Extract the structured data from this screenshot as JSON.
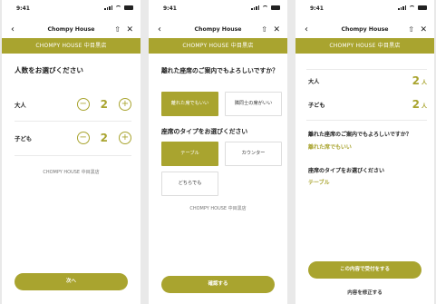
{
  "status": {
    "time": "9:41"
  },
  "nav": {
    "title": "Chompy House",
    "back": "‹",
    "share": "⇧",
    "close": "✕"
  },
  "banner": "CHOMPY HOUSE 中目黒店",
  "screen1": {
    "heading": "人数をお選びください",
    "adult_label": "大人",
    "adult_count": "2",
    "child_label": "子ども",
    "child_count": "2",
    "minus": "−",
    "plus": "+",
    "store": "CHOMPY HOUSE 中目黒店",
    "next_button": "次へ"
  },
  "screen2": {
    "question1": "離れた座席のご案内でもよろしいですか？",
    "q1_options": [
      "離れた席でもいい",
      "隣同士の席がいい"
    ],
    "q1_selected": "離れた席でもいい",
    "question2": "座席のタイプをお選びください",
    "q2_options": [
      "テーブル",
      "カウンター",
      "どちらでも"
    ],
    "q2_selected": "テーブル",
    "store": "CHOMPY HOUSE 中目黒店",
    "confirm_button": "確認する"
  },
  "screen3": {
    "adult_label": "大人",
    "adult_value": "2",
    "child_label": "子ども",
    "child_value": "2",
    "unit": "人",
    "question1": "離れた座席のご案内でもよろしいですか？",
    "answer1": "離れた席でもいい",
    "question2": "座席のタイプをお選びください",
    "answer2": "テーブル",
    "submit_button": "この内容で受付をする",
    "edit_link": "内容を修正する"
  },
  "colors": {
    "accent": "#a9a42f",
    "background": "#e9e9e9"
  }
}
